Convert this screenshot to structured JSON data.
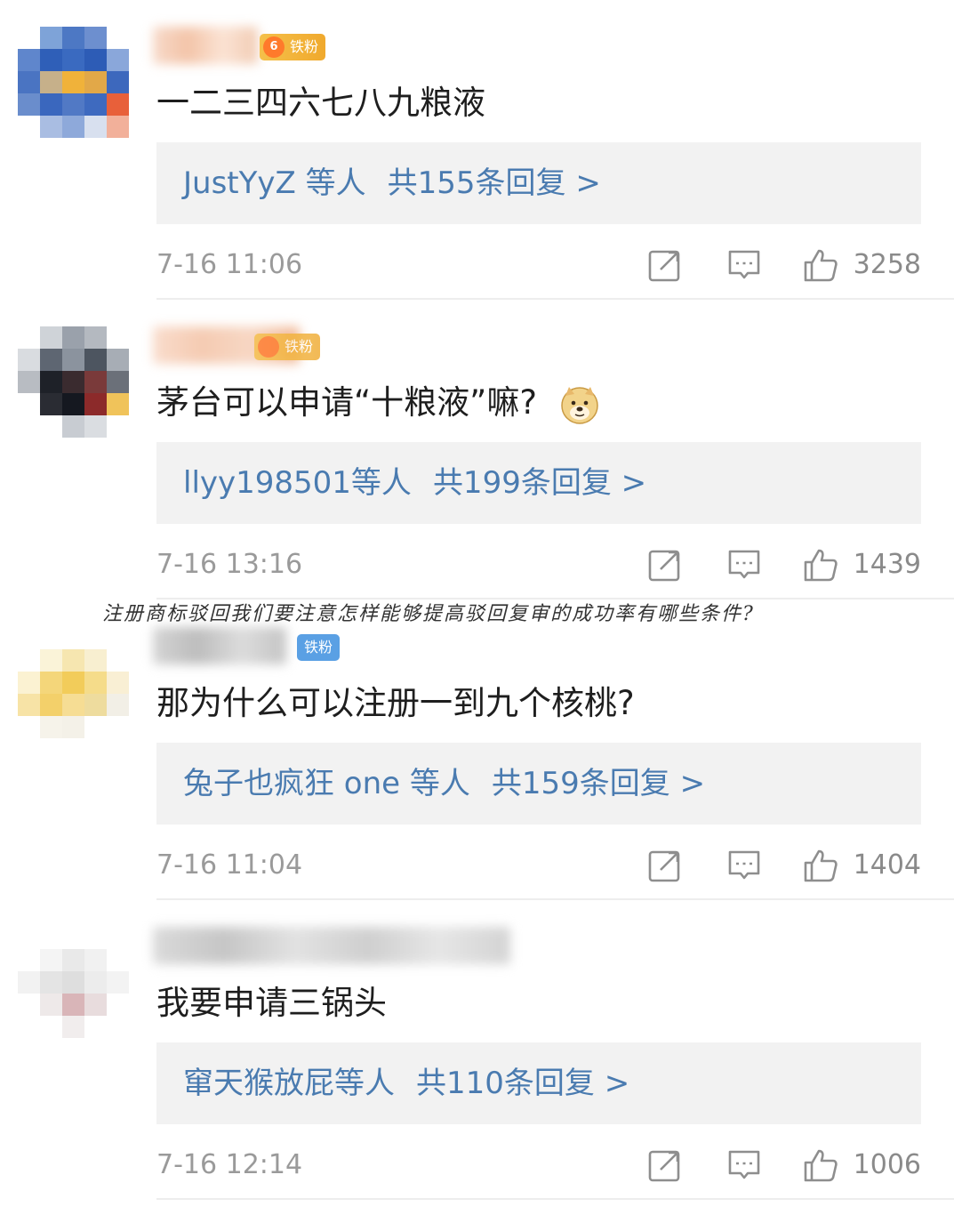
{
  "comments": [
    {
      "badge": "铁粉",
      "badge_level": "6",
      "text": "一二三四六七八九粮液",
      "reply_users": "JustYyZ 等人",
      "reply_count": "共155条回复 >",
      "time": "7-16 11:06",
      "likes": "3258"
    },
    {
      "badge": "铁粉",
      "badge_level": "",
      "text": "茅台可以申请“十粮液”嘛?",
      "reply_users": "llyy198501等人",
      "reply_count": "共199条回复 >",
      "time": "7-16 13:16",
      "likes": "1439"
    },
    {
      "badge": "铁粉",
      "badge_level": "",
      "text": "那为什么可以注册一到九个核桃?",
      "reply_users": "兔子也疯狂 one 等人",
      "reply_count": "共159条回复 >",
      "time": "7-16 11:04",
      "likes": "1404"
    },
    {
      "text": "我要申请三锅头",
      "reply_users": "窜天猴放屁等人",
      "reply_count": "共110条回复 >",
      "time": "7-16 12:14",
      "likes": "1006"
    }
  ],
  "watermark": "注册商标驳回我们要注意怎样能够提高驳回复审的成功率有哪些条件?",
  "icons": {
    "share": "share-icon",
    "reply": "comment-icon",
    "like": "thumbs-up-icon"
  },
  "colors": {
    "reply_link": "#4a7bb0",
    "reply_bg": "#f2f2f2",
    "meta_gray": "#9a9a9a",
    "badge_gold": "#f0a92d",
    "badge_blue": "#5aa0e4"
  }
}
